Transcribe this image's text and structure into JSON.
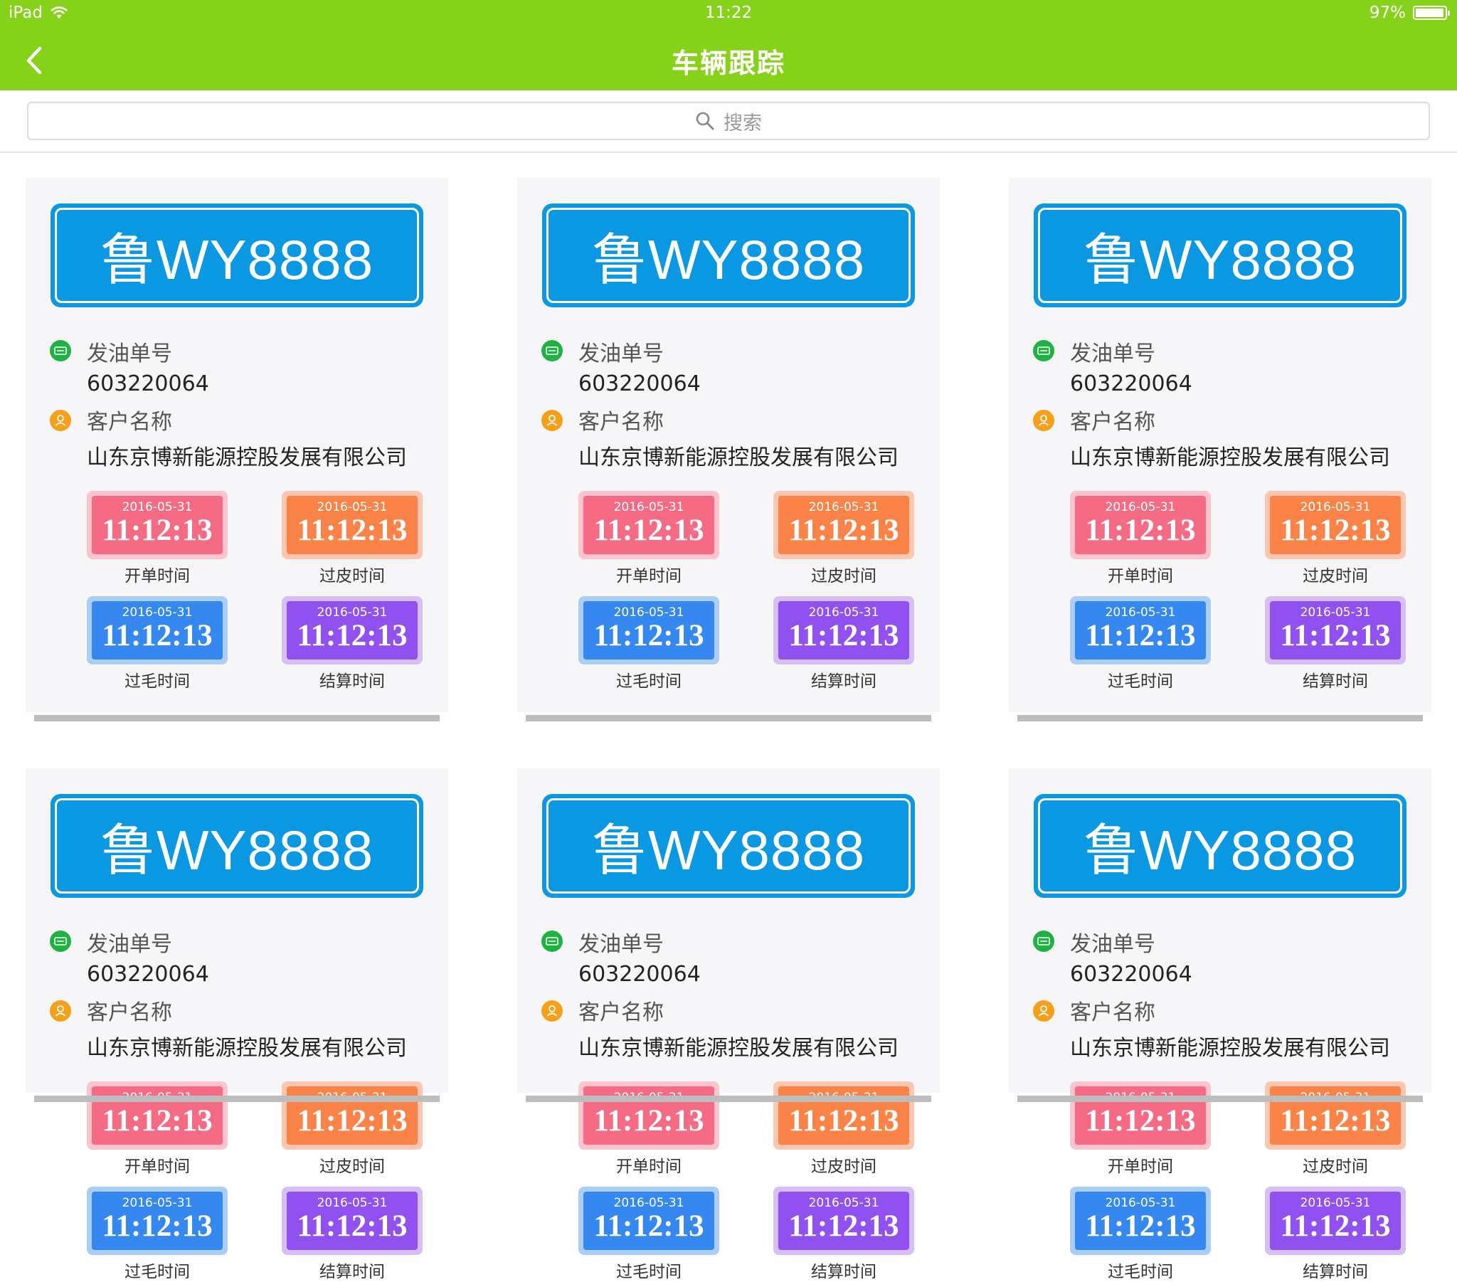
{
  "status_bar": {
    "device": "iPad",
    "time": "11:22",
    "battery": "97%",
    "battery_level": 0.97
  },
  "nav": {
    "title": "车辆跟踪"
  },
  "search": {
    "placeholder": "搜索"
  },
  "labels": {
    "order_no": "发油单号",
    "customer": "客户名称",
    "open_time": "开单时间",
    "tare_time": "过皮时间",
    "gross_time": "过毛时间",
    "settle_time": "结算时间"
  },
  "cards": [
    {
      "plate": "鲁WY8888",
      "order_no": "603220064",
      "customer": "山东京博新能源控股发展有限公司",
      "times": {
        "open": {
          "date": "2016-05-31",
          "time": "11:12:13"
        },
        "tare": {
          "date": "2016-05-31",
          "time": "11:12:13"
        },
        "gross": {
          "date": "2016-05-31",
          "time": "11:12:13"
        },
        "settle": {
          "date": "2016-05-31",
          "time": "11:12:13"
        }
      }
    },
    {
      "plate": "鲁WY8888",
      "order_no": "603220064",
      "customer": "山东京博新能源控股发展有限公司",
      "times": {
        "open": {
          "date": "2016-05-31",
          "time": "11:12:13"
        },
        "tare": {
          "date": "2016-05-31",
          "time": "11:12:13"
        },
        "gross": {
          "date": "2016-05-31",
          "time": "11:12:13"
        },
        "settle": {
          "date": "2016-05-31",
          "time": "11:12:13"
        }
      }
    },
    {
      "plate": "鲁WY8888",
      "order_no": "603220064",
      "customer": "山东京博新能源控股发展有限公司",
      "times": {
        "open": {
          "date": "2016-05-31",
          "time": "11:12:13"
        },
        "tare": {
          "date": "2016-05-31",
          "time": "11:12:13"
        },
        "gross": {
          "date": "2016-05-31",
          "time": "11:12:13"
        },
        "settle": {
          "date": "2016-05-31",
          "time": "11:12:13"
        }
      }
    },
    {
      "plate": "鲁WY8888",
      "order_no": "603220064",
      "customer": "山东京博新能源控股发展有限公司",
      "times": {
        "open": {
          "date": "2016-05-31",
          "time": "11:12:13"
        },
        "tare": {
          "date": "2016-05-31",
          "time": "11:12:13"
        },
        "gross": {
          "date": "2016-05-31",
          "time": "11:12:13"
        },
        "settle": {
          "date": "2016-05-31",
          "time": "11:12:13"
        }
      }
    },
    {
      "plate": "鲁WY8888",
      "order_no": "603220064",
      "customer": "山东京博新能源控股发展有限公司",
      "times": {
        "open": {
          "date": "2016-05-31",
          "time": "11:12:13"
        },
        "tare": {
          "date": "2016-05-31",
          "time": "11:12:13"
        },
        "gross": {
          "date": "2016-05-31",
          "time": "11:12:13"
        },
        "settle": {
          "date": "2016-05-31",
          "time": "11:12:13"
        }
      }
    },
    {
      "plate": "鲁WY8888",
      "order_no": "603220064",
      "customer": "山东京博新能源控股发展有限公司",
      "times": {
        "open": {
          "date": "2016-05-31",
          "time": "11:12:13"
        },
        "tare": {
          "date": "2016-05-31",
          "time": "11:12:13"
        },
        "gross": {
          "date": "2016-05-31",
          "time": "11:12:13"
        },
        "settle": {
          "date": "2016-05-31",
          "time": "11:12:13"
        }
      }
    }
  ],
  "colors": {
    "header": "#86d21a",
    "plate": "#0b98e3",
    "open": "#f66b84",
    "tare": "#fb8348",
    "gross": "#3488ef",
    "settle": "#9150f0"
  }
}
